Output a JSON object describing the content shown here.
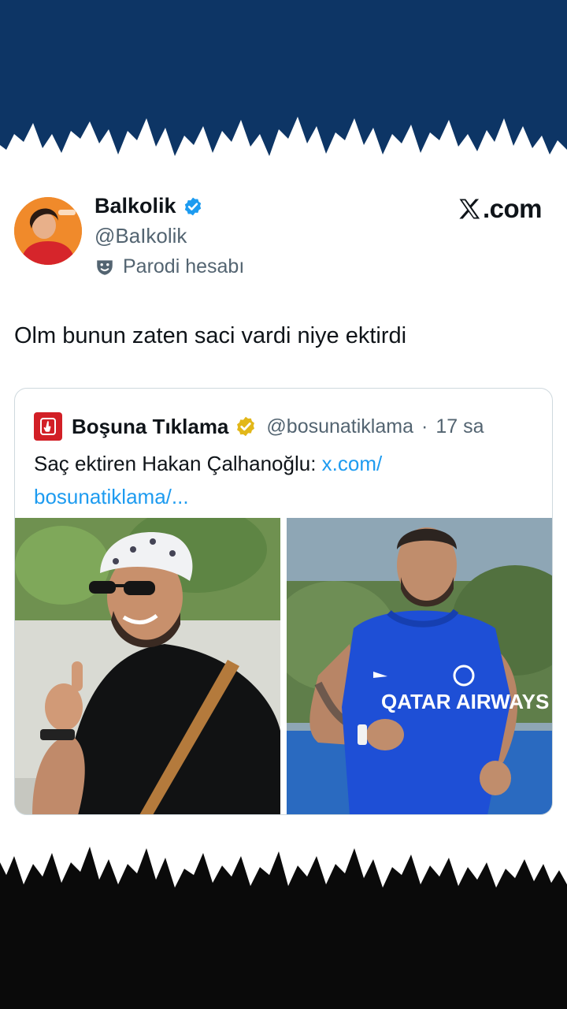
{
  "colors": {
    "top_band": "#0d3565",
    "bottom_band": "#0a0a0a",
    "verified_blue": "#1d9bf0",
    "gold_badge": "#e2b719",
    "link": "#1d9bf0"
  },
  "tweet": {
    "author_name": "Balkolik",
    "author_handle": "@BaIkolik",
    "parody_label": "Parodi hesabı",
    "site": ".com",
    "site_icon": "x-logo-icon",
    "text": "Olm bunun zaten saci vardi niye ektirdi"
  },
  "quoted": {
    "author_name": "Boşuna Tıklama",
    "author_handle": "@bosunatiklama",
    "separator": "·",
    "time": "17 sa",
    "text_prefix": "Saç ektiren Hakan Çalhanoğlu: ",
    "link_line1": "x.com/",
    "link_line2": "bosunatiklama/...",
    "images": [
      {
        "icon": "photo-left",
        "jersey_text": ""
      },
      {
        "icon": "photo-right",
        "jersey_text": "QATAR AIRWAYS"
      }
    ]
  }
}
